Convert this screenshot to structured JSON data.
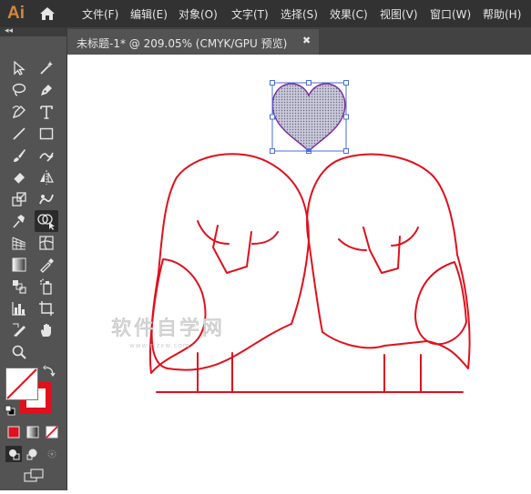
{
  "app": {
    "logo": "Ai"
  },
  "menu": [
    {
      "label": "文件(F)"
    },
    {
      "label": "编辑(E)"
    },
    {
      "label": "对象(O)"
    },
    {
      "label": "文字(T)"
    },
    {
      "label": "选择(S)"
    },
    {
      "label": "效果(C)"
    },
    {
      "label": "视图(V)"
    },
    {
      "label": "窗口(W)"
    },
    {
      "label": "帮助(H)"
    }
  ],
  "toolbar": {
    "collapse": "◂◂"
  },
  "document": {
    "tab_title": "未标题-1* @ 209.05% (CMYK/GPU 预览)",
    "close": "✖"
  },
  "colors": {
    "stroke_red": "#e0101c",
    "selection_blue": "#4a6fd6",
    "ui_dark": "#323232",
    "toolbar_bg": "#535353"
  },
  "watermark": {
    "text": "软件自学网",
    "sub": "www.rjzxw.com"
  }
}
